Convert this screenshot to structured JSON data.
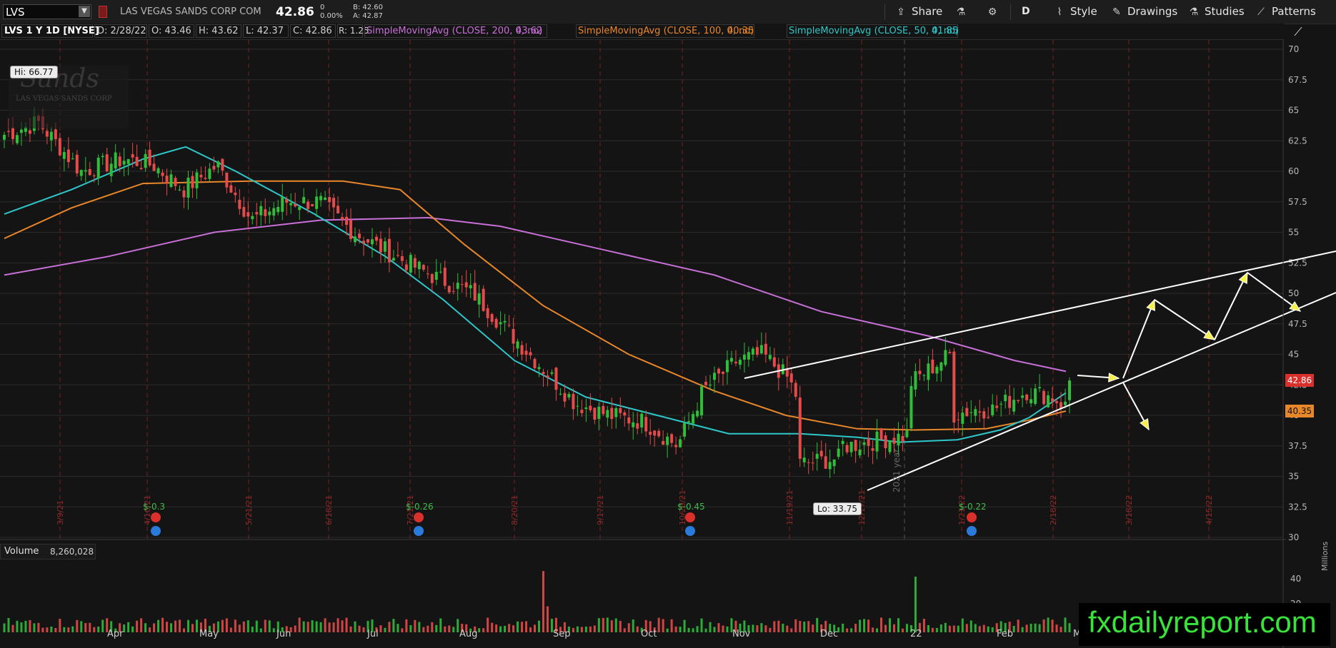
{
  "toolbar": {
    "symbol": "LVS",
    "company": "LAS VEGAS SANDS CORP COM",
    "last_price": "42.86",
    "change_abs": "0",
    "change_pct": "0.00%",
    "bid": "B: 42.60",
    "ask": "A: 42.87",
    "share_label": "Share",
    "period_label": "D",
    "style_label": "Style",
    "drawings_label": "Drawings",
    "studies_label": "Studies",
    "patterns_label": "Patterns"
  },
  "legend": {
    "description": "LVS 1 Y 1D [NYSE]",
    "date": "D: 2/28/22",
    "open": "O: 43.46",
    "high": "H: 43.62",
    "low": "L: 42.37",
    "close": "C: 42.86",
    "range": "R: 1.25",
    "sma200_label": "SimpleMovingAvg (CLOSE, 200, 0, no)",
    "sma200_value": "43.62",
    "sma100_label": "SimpleMovingAvg (CLOSE, 100, 0, no)",
    "sma100_value": "40.35",
    "sma50_label": "SimpleMovingAvg (CLOSE, 50, 0, no)",
    "sma50_value": "41.85"
  },
  "colors": {
    "sma200": "#c86fd8",
    "sma100": "#e8862a",
    "sma50": "#2ec7c9",
    "up_candle": "#2fbd3a",
    "down_candle": "#e64a4a",
    "grid": "#2b2b2b",
    "event_line": "#7a1e1e",
    "price_tag": "#d9302c",
    "sma100_tag": "#e8862a"
  },
  "chart": {
    "hi_label": "Hi: 66.77",
    "lo_label": "Lo: 33.75",
    "current_price_tag": "42.86",
    "sma100_tag": "40.35",
    "year_marker": "2021 year",
    "logo_text": "Sands",
    "logo_subtext": "LAS VEGAS SANDS CORP"
  },
  "chart_data": {
    "type": "candlestick",
    "y_axis": {
      "ticks": [
        "70",
        "67.5",
        "65",
        "62.5",
        "60",
        "57.5",
        "55",
        "52.5",
        "50",
        "47.5",
        "45",
        "42.5",
        "40",
        "37.5",
        "35",
        "32.5",
        "30"
      ]
    },
    "x_axis": {
      "months": [
        "Apr",
        "May",
        "Jun",
        "Jul",
        "Aug",
        "Sep",
        "Oct",
        "Nov",
        "Dec",
        "22",
        "Feb",
        "M"
      ]
    },
    "event_dates": [
      "3/9/21",
      "4/16/21",
      "5/21/21",
      "6/18/21",
      "7/21/21",
      "8/20/21",
      "9/17/21",
      "10/20/21",
      "11/19/21",
      "12/17/21",
      "1/21/22",
      "2/18/22",
      "3/18/22",
      "4/15/22"
    ],
    "dividend_labels": [
      {
        "label": "$-0.3",
        "date": "4/16/21"
      },
      {
        "label": "$-0.26",
        "date": "7/21/21"
      },
      {
        "label": "$-0.45",
        "date": "10/20/21"
      },
      {
        "label": "$-0.22",
        "date": "1/21/22"
      }
    ],
    "summary": {
      "high": 66.77,
      "low": 33.75,
      "last": 42.86
    }
  },
  "volume": {
    "label": "Volume",
    "value": "8,260,028",
    "ticks": [
      "40",
      "20"
    ],
    "units": "Millions"
  },
  "watermark": "fxdailyreport.com"
}
